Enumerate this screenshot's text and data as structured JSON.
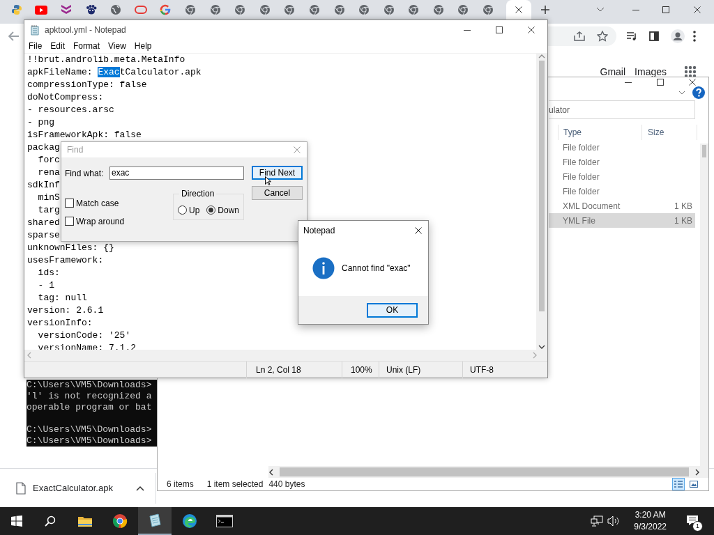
{
  "browser": {
    "tabs": [
      {
        "kind": "python",
        "selected": false
      },
      {
        "kind": "youtube",
        "selected": false
      },
      {
        "kind": "chevrons",
        "selected": false
      },
      {
        "kind": "paw",
        "selected": false
      },
      {
        "kind": "globe",
        "selected": false
      },
      {
        "kind": "pill",
        "selected": false
      },
      {
        "kind": "google",
        "selected": false
      },
      {
        "kind": "chrome",
        "selected": false
      },
      {
        "kind": "chrome",
        "selected": false
      },
      {
        "kind": "chrome",
        "selected": false
      },
      {
        "kind": "chrome",
        "selected": false
      },
      {
        "kind": "chrome",
        "selected": false
      },
      {
        "kind": "chrome",
        "selected": false
      },
      {
        "kind": "chrome",
        "selected": false
      },
      {
        "kind": "chrome",
        "selected": false
      },
      {
        "kind": "chrome",
        "selected": false
      },
      {
        "kind": "chrome",
        "selected": false
      },
      {
        "kind": "chrome",
        "selected": false
      },
      {
        "kind": "chrome",
        "selected": false
      },
      {
        "kind": "chrome",
        "selected": false
      },
      {
        "kind": "blank",
        "selected": true
      }
    ],
    "links": [
      "Gmail",
      "Images"
    ],
    "download": {
      "file_name": "ExactCalculator.apk"
    }
  },
  "console": {
    "blocks": [
      [
        "C:\\Users\\VM5\\Downloads>",
        "'l' is not recognized a",
        "operable program or bat"
      ],
      [
        "C:\\Users\\VM5\\Downloads>",
        "C:\\Users\\VM5\\Downloads>"
      ]
    ]
  },
  "explorer": {
    "address": "ulator",
    "columns": [
      "Type",
      "Size"
    ],
    "rows": [
      {
        "type": "File folder",
        "selected": false
      },
      {
        "type": "File folder",
        "selected": false
      },
      {
        "type": "File folder",
        "selected": false
      },
      {
        "type": "File folder",
        "selected": false
      },
      {
        "type": "XML Document",
        "size": "1 KB",
        "selected": false
      },
      {
        "type": "YML File",
        "size": "1 KB",
        "selected": true
      }
    ],
    "status": {
      "item_count": "6 items",
      "selection": "1 item selected",
      "selection_size": "440 bytes"
    },
    "views": [
      {
        "kind": "details",
        "selected": true
      },
      {
        "kind": "large_icons",
        "selected": false
      }
    ]
  },
  "notepad": {
    "title": "apktool.yml - Notepad",
    "menu": [
      "File",
      "Edit",
      "Format",
      "View",
      "Help"
    ],
    "lines": [
      "!!brut.androlib.meta.MetaInfo",
      {
        "segments": [
          {
            "text": "apkFileName: ",
            "selected": false
          },
          {
            "text": "Exac",
            "selected": true
          },
          {
            "text": "tCalculator.apk",
            "selected": false
          }
        ]
      },
      "compressionType: false",
      "doNotCompress:",
      "- resources.arsc",
      "- png",
      "isFrameworkApk: false",
      "packag",
      "  forc",
      "  rena",
      "sdkInf",
      "  minS",
      "  targ",
      "shared",
      "sparse",
      "unknownFiles: {}",
      "usesFramework:",
      "  ids:",
      "  - 1",
      "  tag: null",
      "version: 2.6.1",
      "versionInfo:",
      "  versionCode: '25'",
      "  versionName: 7.1.2"
    ],
    "status": {
      "position": "Ln 2, Col 18",
      "zoom": "100%",
      "line_ending": "Unix (LF)",
      "encoding": "UTF-8"
    }
  },
  "find_dialog": {
    "title": "Find",
    "find_what_label": "Find what:",
    "find_what": "exac",
    "buttons": [
      {
        "label": "Find Next",
        "focused": true
      },
      {
        "label": "Cancel",
        "focused": false
      }
    ],
    "direction": {
      "label": "Direction",
      "options": [
        {
          "label": "Up",
          "selected": false
        },
        {
          "label": "Down",
          "selected": true
        }
      ]
    },
    "options": [
      {
        "label": "Match case",
        "checked": false
      },
      {
        "label": "Wrap around",
        "checked": false
      }
    ]
  },
  "message_box": {
    "title": "Notepad",
    "message": "Cannot find \"exac\"",
    "button": "OK"
  },
  "taskbar": {
    "apps": [
      {
        "kind": "explorer",
        "active": false
      },
      {
        "kind": "chrome",
        "active": false
      },
      {
        "kind": "notepad",
        "active": true
      },
      {
        "kind": "edge",
        "active": false
      },
      {
        "kind": "terminal",
        "active": false
      }
    ],
    "time": "3:20 AM",
    "date": "9/3/2022",
    "notifications": "1"
  }
}
